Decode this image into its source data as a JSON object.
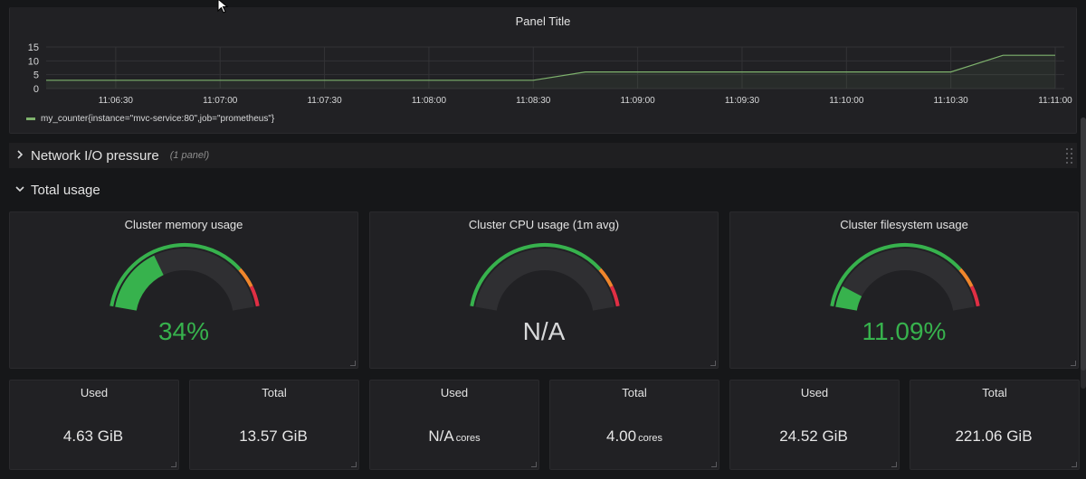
{
  "graph": {
    "title": "Panel Title",
    "y_ticks": [
      "15",
      "10",
      "5",
      "0"
    ],
    "x_ticks": [
      "11:06:30",
      "11:07:00",
      "11:07:30",
      "11:08:00",
      "11:08:30",
      "11:09:00",
      "11:09:30",
      "11:10:00",
      "11:10:30",
      "11:11:00"
    ],
    "legend": "my_counter{instance=\"mvc-service:80\",job=\"prometheus\"}",
    "series_color": "#7eb26d"
  },
  "chart_data": {
    "type": "line",
    "x": [
      "11:06:10",
      "11:08:30",
      "11:08:45",
      "11:10:30",
      "11:10:45",
      "11:11:00"
    ],
    "series": [
      {
        "name": "my_counter{instance=\"mvc-service:80\",job=\"prometheus\"}",
        "values": [
          3,
          3,
          6,
          6,
          12,
          12
        ]
      }
    ],
    "ylim": [
      0,
      15
    ],
    "grid": true,
    "legend_position": "bottom-left"
  },
  "rows": {
    "network": {
      "title": "Network I/O pressure",
      "count": "(1 panel)"
    },
    "total": {
      "title": "Total usage"
    }
  },
  "gauges": [
    {
      "title": "Cluster memory usage",
      "value": "34%",
      "fraction": 0.34,
      "value_color": "#37b24d"
    },
    {
      "title": "Cluster CPU usage (1m avg)",
      "value": "N/A",
      "fraction": 0,
      "value_color": "#d8d9da"
    },
    {
      "title": "Cluster filesystem usage",
      "value": "11.09%",
      "fraction": 0.1109,
      "value_color": "#37b24d"
    }
  ],
  "gauge_colors": {
    "green": "#37b24d",
    "orange": "#f0862c",
    "red": "#e02f44",
    "track": "#2f2f32"
  },
  "stats": [
    {
      "label": "Used",
      "value": "4.63 GiB",
      "unit": ""
    },
    {
      "label": "Total",
      "value": "13.57 GiB",
      "unit": ""
    },
    {
      "label": "Used",
      "value": "N/A",
      "unit": "cores"
    },
    {
      "label": "Total",
      "value": "4.00",
      "unit": "cores"
    },
    {
      "label": "Used",
      "value": "24.52 GiB",
      "unit": ""
    },
    {
      "label": "Total",
      "value": "221.06 GiB",
      "unit": ""
    }
  ]
}
